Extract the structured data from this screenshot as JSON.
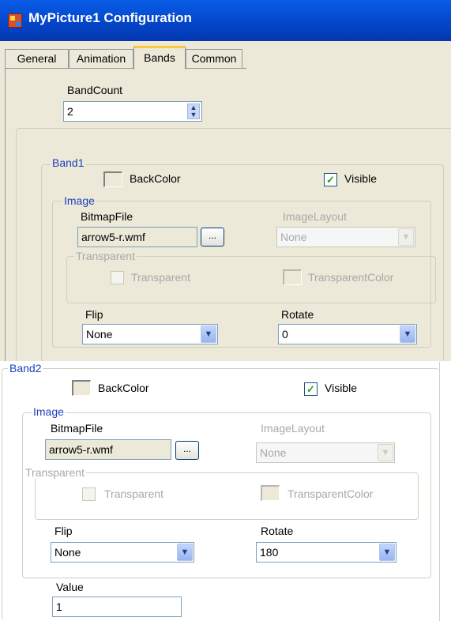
{
  "window": {
    "title": "MyPicture1 Configuration"
  },
  "tabs": [
    {
      "label": "General"
    },
    {
      "label": "Animation"
    },
    {
      "label": "Bands"
    },
    {
      "label": "Common"
    }
  ],
  "band_count": {
    "label": "BandCount",
    "value": "2"
  },
  "band1": {
    "title": "Band1",
    "backcolor_label": "BackColor",
    "visible_label": "Visible",
    "visible_checked": true,
    "image": {
      "title": "Image",
      "bitmap_label": "BitmapFile",
      "bitmap_value": "arrow5-r.wmf",
      "browse_label": "...",
      "layout_label": "ImageLayout",
      "layout_value": "None"
    },
    "transparent": {
      "title": "Transparent",
      "checkbox_label": "Transparent",
      "color_label": "TransparentColor"
    },
    "flip_label": "Flip",
    "flip_value": "None",
    "rotate_label": "Rotate",
    "rotate_value": "0"
  },
  "band2": {
    "title": "Band2",
    "backcolor_label": "BackColor",
    "visible_label": "Visible",
    "visible_checked": true,
    "image": {
      "title": "Image",
      "bitmap_label": "BitmapFile",
      "bitmap_value": "arrow5-r.wmf",
      "browse_label": "...",
      "layout_label": "ImageLayout",
      "layout_value": "None"
    },
    "transparent": {
      "title": "Transparent",
      "checkbox_label": "Transparent",
      "color_label": "TransparentColor"
    },
    "flip_label": "Flip",
    "flip_value": "None",
    "rotate_label": "Rotate",
    "rotate_value": "180",
    "value_label": "Value",
    "value_value": "1"
  },
  "icons": {
    "app": "app-picture-icon",
    "spin": "spinner-arrows-icon",
    "dropdown": "chevron-down-icon",
    "check": "checkmark-icon"
  },
  "colors": {
    "titlebar": "#0446c9",
    "dialog_bg": "#ece9d8",
    "group_title": "#1f3fbf",
    "active_tab_accent": "#ffc83c"
  }
}
